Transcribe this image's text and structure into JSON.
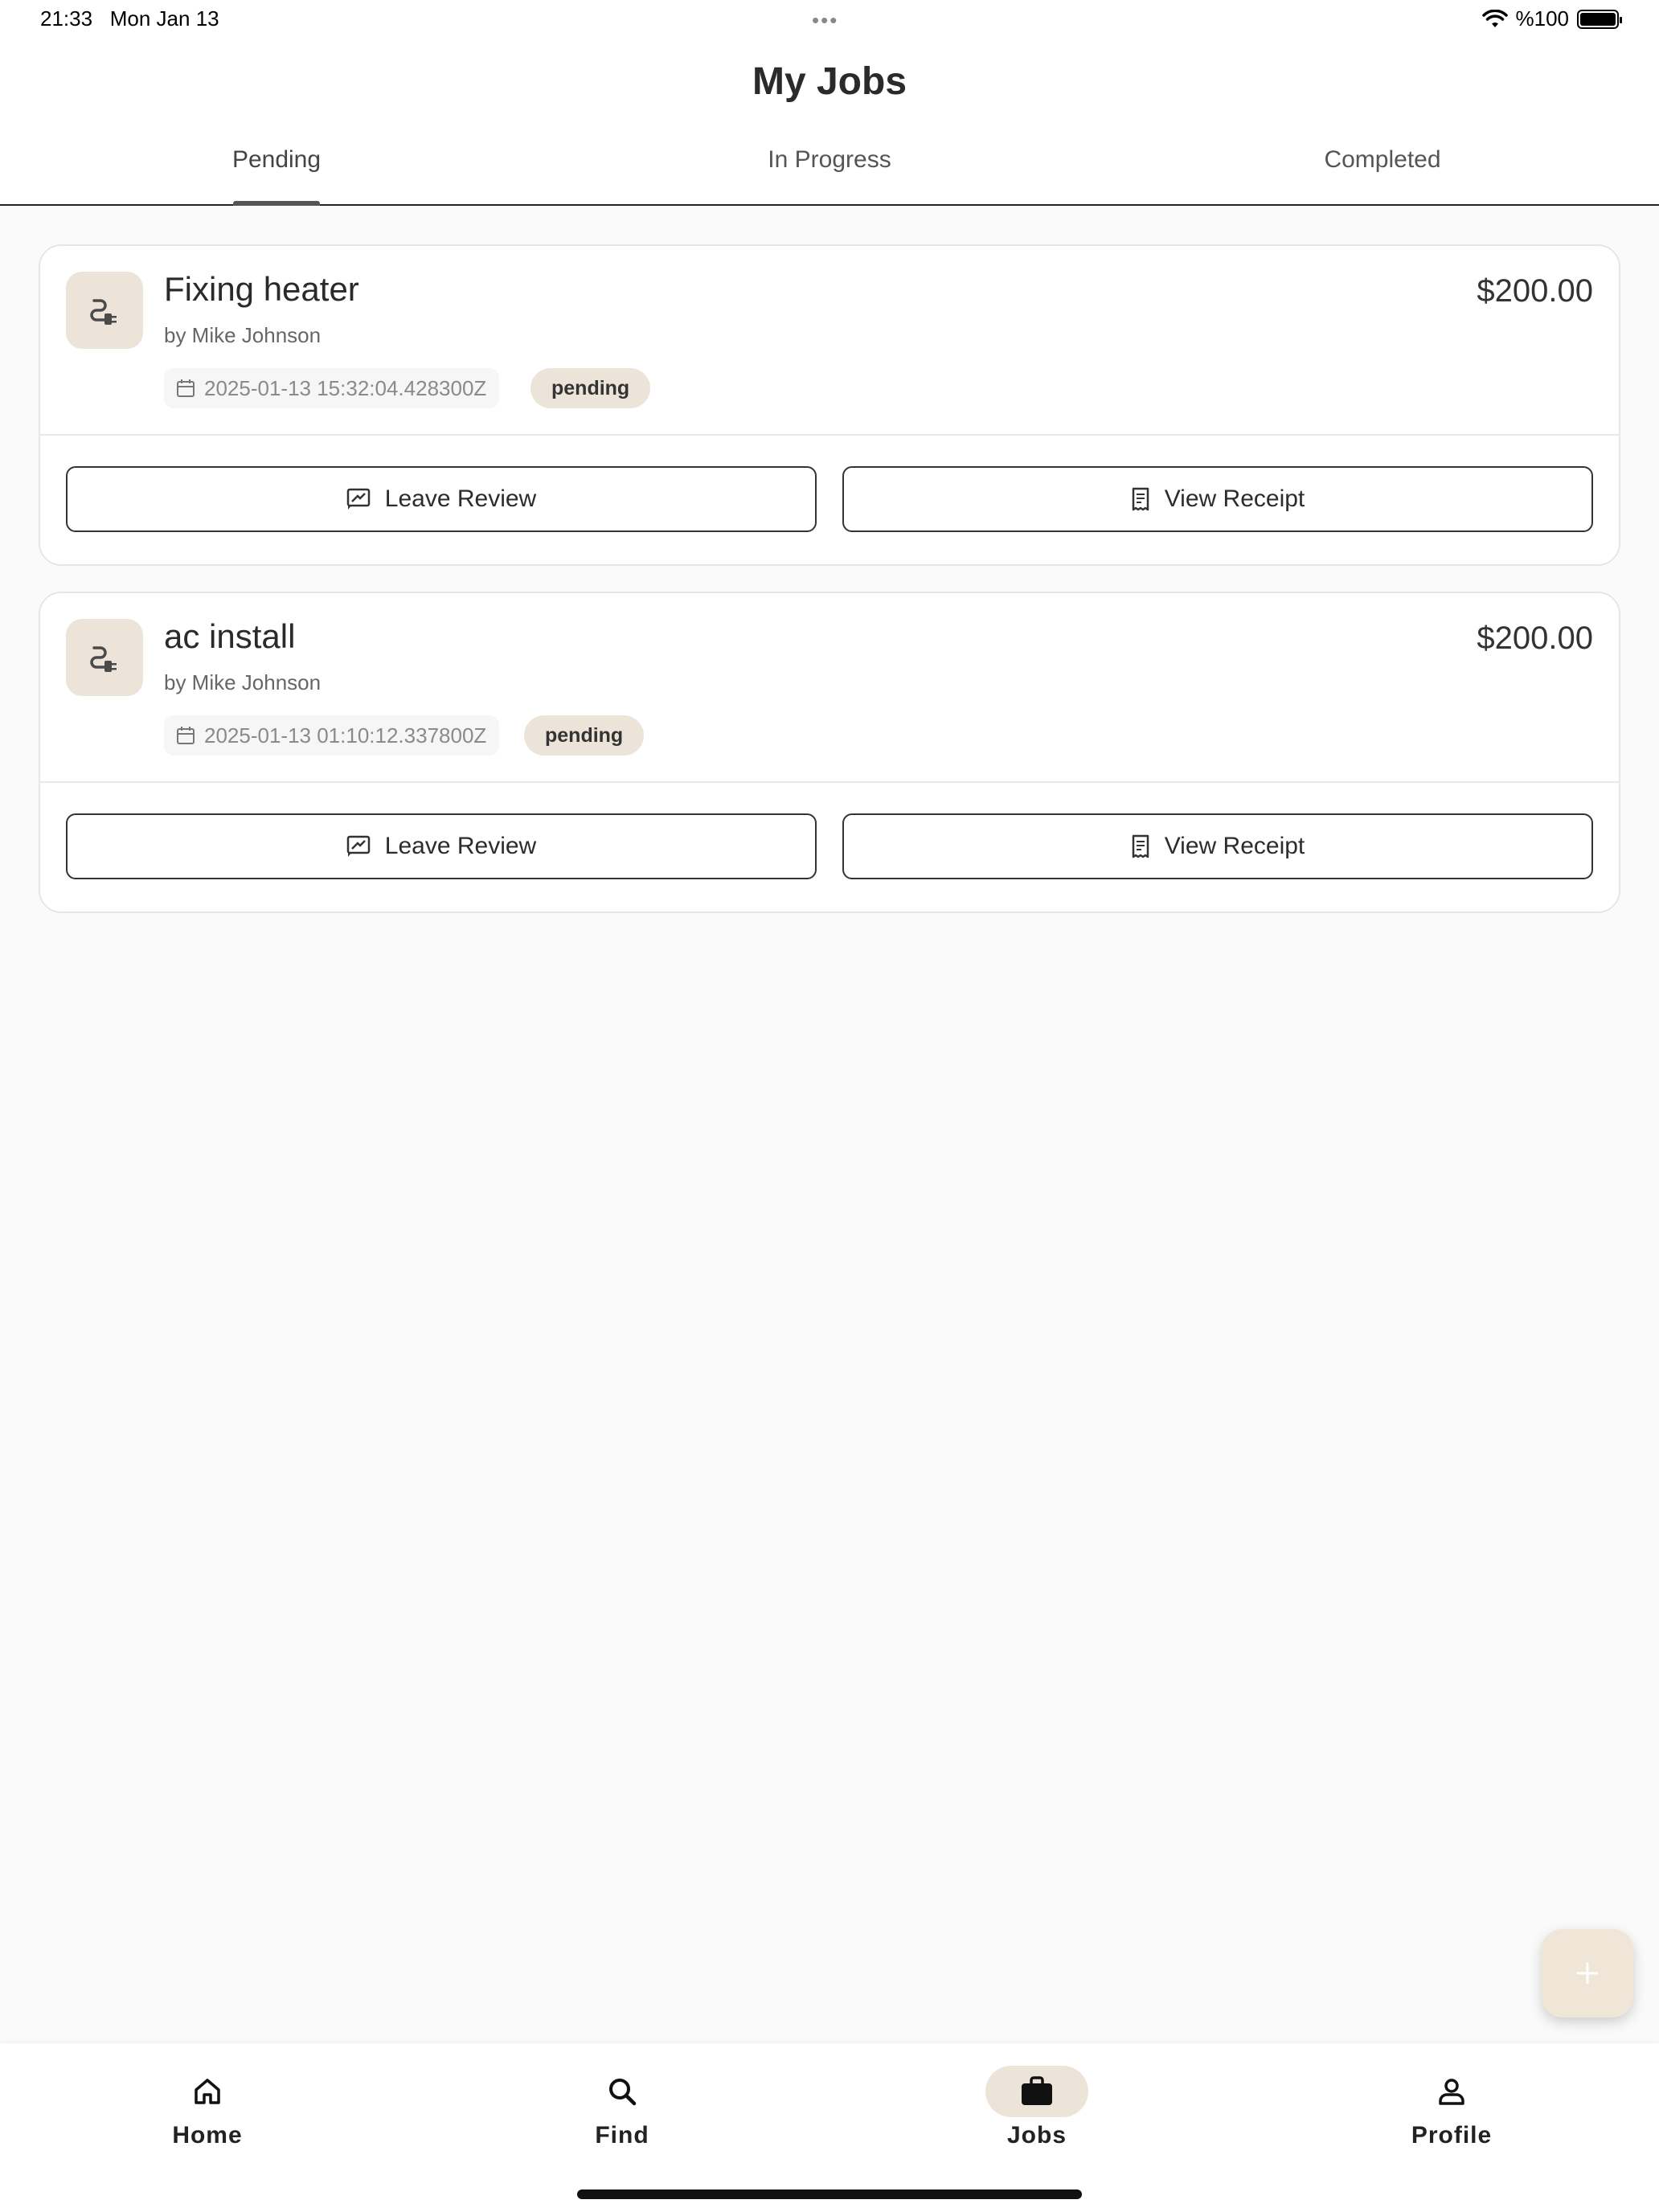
{
  "status_bar": {
    "time": "21:33",
    "date": "Mon Jan 13",
    "battery": "%100"
  },
  "header": {
    "title": "My Jobs"
  },
  "tabs": [
    {
      "label": "Pending",
      "active": true
    },
    {
      "label": "In Progress",
      "active": false
    },
    {
      "label": "Completed",
      "active": false
    }
  ],
  "jobs": [
    {
      "title": "Fixing heater",
      "author": "by Mike Johnson",
      "price": "$200.00",
      "date": "2025-01-13 15:32:04.428300Z",
      "status": "pending",
      "review_label": "Leave Review",
      "receipt_label": "View Receipt"
    },
    {
      "title": "ac install",
      "author": "by Mike Johnson",
      "price": "$200.00",
      "date": "2025-01-13 01:10:12.337800Z",
      "status": "pending",
      "review_label": "Leave Review",
      "receipt_label": "View Receipt"
    }
  ],
  "fab": {
    "icon": "plus-icon"
  },
  "bottom_nav": [
    {
      "label": "Home",
      "icon": "home-icon",
      "active": false
    },
    {
      "label": "Find",
      "icon": "search-icon",
      "active": false
    },
    {
      "label": "Jobs",
      "icon": "briefcase-icon",
      "active": true
    },
    {
      "label": "Profile",
      "icon": "person-icon",
      "active": false
    }
  ],
  "colors": {
    "accent_beige": "#ece4d8",
    "text_dark": "#2b2b2b",
    "background": "#fafafa"
  }
}
